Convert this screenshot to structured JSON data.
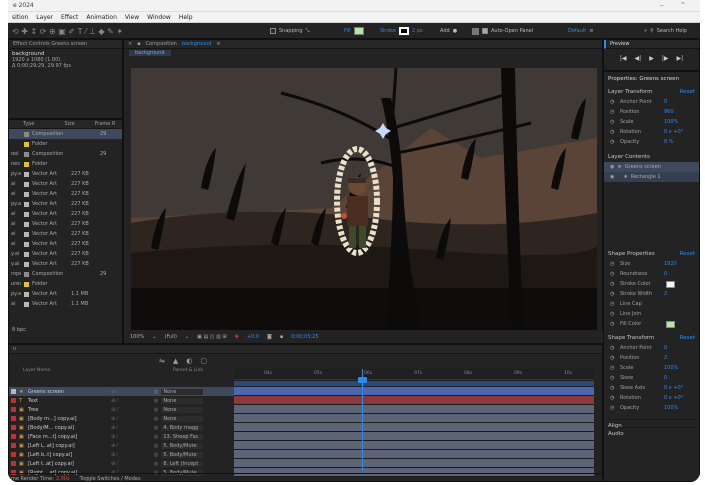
{
  "app": {
    "title": "e 2024"
  },
  "menu": [
    "sition",
    "Layer",
    "Effect",
    "Animation",
    "View",
    "Window",
    "Help"
  ],
  "toolbar": {
    "snapping": "Snapping",
    "fill": "Fill",
    "stroke": "Stroke",
    "stroke_px": "2 px",
    "add": "Add",
    "auto_open": "Auto-Open Panel",
    "workspace": "Default",
    "search": "Search Help"
  },
  "effect_controls": {
    "tab": "Effect Controls Greens screen",
    "comp_name": "background",
    "info1": "1920 x 1080 (1.00)",
    "info2": "Δ 0;00;29;29, 29.97 fps"
  },
  "project": {
    "columns": [
      "Type",
      "Size",
      "Frame R"
    ],
    "items": [
      {
        "left": "",
        "type": "Composition",
        "size": "",
        "fr": "29",
        "color": "#8b8b8b",
        "selected": true
      },
      {
        "left": "",
        "type": "Folder",
        "size": "",
        "fr": "",
        "color": "#e0c030",
        "selected": false
      },
      {
        "left": "ool",
        "type": "Composition",
        "size": "",
        "fr": "29",
        "color": "#8b8b8b",
        "selected": false
      },
      {
        "left": "nes",
        "type": "Folder",
        "size": "",
        "fr": "",
        "color": "#e0c030",
        "selected": false
      },
      {
        "left": "py.ai",
        "type": "Vector Art",
        "size": "227 KB",
        "fr": "",
        "color": "#b8b8b8",
        "selected": false
      },
      {
        "left": "ai",
        "type": "Vector Art",
        "size": "227 KB",
        "fr": "",
        "color": "#b8b8b8",
        "selected": false
      },
      {
        "left": "ai",
        "type": "Vector Art",
        "size": "227 KB",
        "fr": "",
        "color": "#b8b8b8",
        "selected": false
      },
      {
        "left": "py.ai",
        "type": "Vector Art",
        "size": "227 KB",
        "fr": "",
        "color": "#b8b8b8",
        "selected": false
      },
      {
        "left": "ai",
        "type": "Vector Art",
        "size": "227 KB",
        "fr": "",
        "color": "#b8b8b8",
        "selected": false
      },
      {
        "left": "ai",
        "type": "Vector Art",
        "size": "227 KB",
        "fr": "",
        "color": "#b8b8b8",
        "selected": false
      },
      {
        "left": "ai",
        "type": "Vector Art",
        "size": "227 KB",
        "fr": "",
        "color": "#b8b8b8",
        "selected": false
      },
      {
        "left": "ai",
        "type": "Vector Art",
        "size": "227 KB",
        "fr": "",
        "color": "#b8b8b8",
        "selected": false
      },
      {
        "left": "y.ai",
        "type": "Vector Art",
        "size": "227 KB",
        "fr": "",
        "color": "#b8b8b8",
        "selected": false
      },
      {
        "left": "y.ai",
        "type": "Vector Art",
        "size": "227 KB",
        "fr": "",
        "color": "#b8b8b8",
        "selected": false
      },
      {
        "left": "rope",
        "type": "Composition",
        "size": "",
        "fr": "29",
        "color": "#8b8b8b",
        "selected": false
      },
      {
        "left": "ures",
        "type": "Folder",
        "size": "",
        "fr": "",
        "color": "#e0c030",
        "selected": false
      },
      {
        "left": "py.ai",
        "type": "Vector Art",
        "size": "1.1 MB",
        "fr": "",
        "color": "#b8b8b8",
        "selected": false
      },
      {
        "left": "ai",
        "type": "Vector Art",
        "size": "1.1 MB",
        "fr": "",
        "color": "#b8b8b8",
        "selected": false
      }
    ],
    "bpc": "8 bpc"
  },
  "composition": {
    "tab_label": "Composition",
    "comp_name": "background",
    "breadcrumb": "background",
    "zoom": "100%",
    "resolution": "(Full)",
    "channel": "+0.0",
    "timecode": "0;00;05;25"
  },
  "timeline": {
    "tab": "n",
    "columns": {
      "layer_name": "Layer Name",
      "parent": "Parent & Link"
    },
    "layers": [
      {
        "num": "★",
        "name": "Greens screen",
        "parent": "None",
        "color": "#b8b8b8",
        "selected": true
      },
      {
        "num": "T",
        "name": "Text",
        "parent": "None",
        "color": "#c03030",
        "selected": false
      },
      {
        "num": "▣",
        "name": "Tree",
        "parent": "None",
        "color": "#c03030",
        "selected": false
      },
      {
        "num": "▣",
        "name": "[Body m...] copy.ai]",
        "parent": "None",
        "color": "#c03030",
        "selected": false
      },
      {
        "num": "▣",
        "name": "[Body/M... copy.ai]",
        "parent": "4. Body magg",
        "color": "#c03030",
        "selected": false
      },
      {
        "num": "▣",
        "name": "[Face m...t] copy.ai]",
        "parent": "13. Sheep Fac",
        "color": "#c03030",
        "selected": false
      },
      {
        "num": "▣",
        "name": "[Left L..at] copy.ai]",
        "parent": "5. Body/Mute",
        "color": "#c03030",
        "selected": false
      },
      {
        "num": "▣",
        "name": "[Left b..t] copy.ai]",
        "parent": "5. Body/Mute",
        "color": "#c03030",
        "selected": false
      },
      {
        "num": "▣",
        "name": "[Left t..at] copy.ai]",
        "parent": "8. Left (Incept",
        "color": "#c03030",
        "selected": false
      },
      {
        "num": "▣",
        "name": "[Right ...at] copy.ai]",
        "parent": "5. Body/Mute",
        "color": "#c03030",
        "selected": false
      }
    ],
    "ruler": [
      "04s",
      "05s",
      "06s",
      "07s",
      "08s",
      "09s",
      "10s"
    ],
    "render_label": "me Render Time:",
    "render_value": "3.00s",
    "toggle_label": "Toggle Switches / Modes"
  },
  "preview": {
    "title": "Preview"
  },
  "properties": {
    "title": "Properties: Greens screen",
    "layer_transform": {
      "title": "Layer Transform",
      "reset": "Reset",
      "rows": [
        {
          "name": "Anchor Point",
          "value": "0"
        },
        {
          "name": "Position",
          "value": "960"
        },
        {
          "name": "Scale",
          "value": "100%"
        },
        {
          "name": "Rotation",
          "value": "0 x +0°"
        },
        {
          "name": "Opacity",
          "value": "0 %"
        }
      ]
    },
    "layer_contents": {
      "title": "Layer Contents",
      "items": [
        "Greens screen",
        "Rectangle 1"
      ]
    },
    "shape_properties": {
      "title": "Shape Properties",
      "reset": "Reset",
      "rows": [
        {
          "name": "Size",
          "value": "1920"
        },
        {
          "name": "Roundness",
          "value": "0"
        },
        {
          "name": "Stroke Color",
          "value": ""
        },
        {
          "name": "Stroke Width",
          "value": "2"
        },
        {
          "name": "Line Cap",
          "value": ""
        },
        {
          "name": "Line Join",
          "value": ""
        },
        {
          "name": "Fill Color",
          "value": ""
        }
      ]
    },
    "shape_transform": {
      "title": "Shape Transform",
      "reset": "Reset",
      "rows": [
        {
          "name": "Anchor Point",
          "value": "0"
        },
        {
          "name": "Position",
          "value": "2"
        },
        {
          "name": "Scale",
          "value": "100%"
        },
        {
          "name": "Skew",
          "value": "0"
        },
        {
          "name": "Skew Axis",
          "value": "0 x +0°"
        },
        {
          "name": "Rotation",
          "value": "0 x +0°"
        },
        {
          "name": "Opacity",
          "value": "100%"
        }
      ]
    },
    "align": "Align",
    "audio": "Audio"
  }
}
